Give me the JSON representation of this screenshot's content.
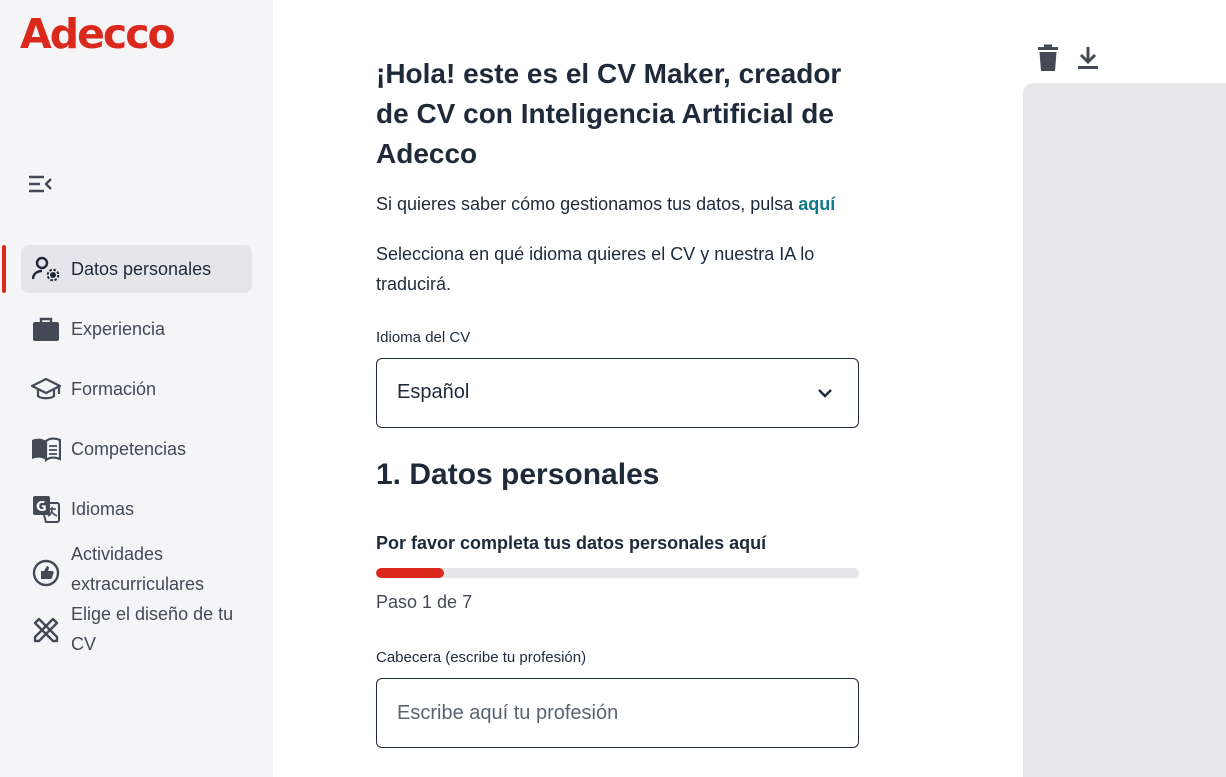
{
  "brand": {
    "logo_text": "Adecco",
    "color": "#da291c"
  },
  "sidebar": {
    "collapse_icon": "menu-collapse-icon",
    "items": [
      {
        "label": "Datos personales",
        "icon": "user-settings-icon",
        "active": true
      },
      {
        "label": "Experiencia",
        "icon": "briefcase-icon",
        "active": false
      },
      {
        "label": "Formación",
        "icon": "graduation-cap-icon",
        "active": false
      },
      {
        "label": "Competencias",
        "icon": "book-icon",
        "active": false
      },
      {
        "label": "Idiomas",
        "icon": "translate-icon",
        "active": false
      },
      {
        "label_line1": "Actividades",
        "label_line2": "extracurriculares",
        "icon": "thumbs-up-icon",
        "active": false
      },
      {
        "label_line1": "Elige el diseño de tu",
        "label_line2": "CV",
        "icon": "design-tools-icon",
        "active": false
      }
    ]
  },
  "main": {
    "title": "¡Hola! este es el CV Maker, creador de CV con Inteligencia Artificial de Adecco",
    "privacy_text": "Si quieres saber cómo gestionamos tus datos, pulsa",
    "privacy_link": "aquí",
    "language_description": "Selecciona en qué idioma quieres el CV y nuestra IA lo traducirá.",
    "language_field": {
      "label": "Idioma del CV",
      "value": "Español"
    },
    "section_title": "1. Datos personales",
    "progress": {
      "label": "Por favor completa tus datos personales aquí",
      "fraction": 0.14,
      "step_text": "Paso 1 de 7"
    },
    "header_field": {
      "label": "Cabecera (escribe tu profesión)",
      "placeholder": "Escribe aquí tu profesión",
      "value": ""
    }
  },
  "preview_toolbar": {
    "delete_icon": "trash-icon",
    "download_icon": "download-icon"
  },
  "colors": {
    "accent": "#da291c",
    "link": "#0f7a8c",
    "text": "#1e2a3a",
    "sidebar_bg": "#f5f5f7",
    "preview_bg": "#e8e8eb"
  }
}
